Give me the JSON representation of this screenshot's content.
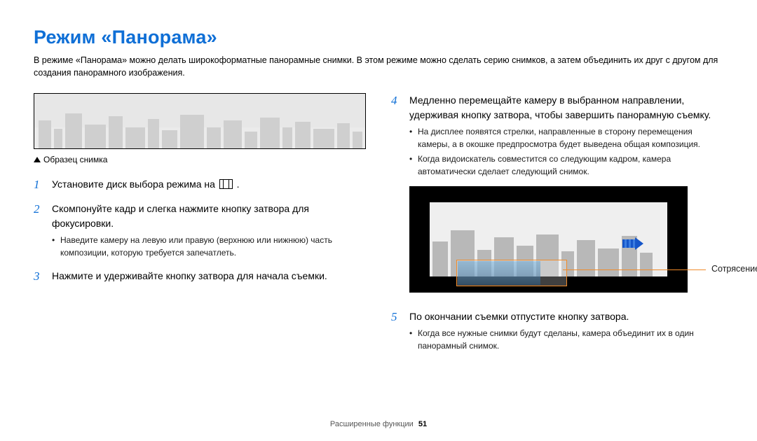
{
  "title": "Режим «Панорама»",
  "intro": "В режиме «Панорама» можно делать широкоформатные панорамные снимки. В этом режиме можно сделать серию снимков, а затем объединить их друг с другом для создания панорамного изображения.",
  "sample_caption": "Образец снимка",
  "left_steps": [
    {
      "num": "1",
      "text_pre": "Установите диск выбора режима на ",
      "text_post": " ."
    },
    {
      "num": "2",
      "text": "Скомпонуйте кадр и слегка нажмите кнопку затвора для фокусировки.",
      "sub": [
        "Наведите камеру на левую или правую (верхнюю или нижнюю) часть композиции, которую требуется запечатлеть."
      ]
    },
    {
      "num": "3",
      "text": "Нажмите и удерживайте кнопку затвора для начала съемки."
    }
  ],
  "right": {
    "step4": {
      "num": "4",
      "text": "Медленно перемещайте камеру в выбранном направлении, удерживая кнопку затвора, чтобы завершить панорамную съемку.",
      "sub": [
        "На дисплее появятся стрелки, направленные в сторону перемещения камеры, а в окошке предпросмотра будет выведена общая композиция.",
        "Когда видоискатель совместится со следующим кадром, камера автоматически сделает следующий снимок."
      ]
    },
    "callout": "Сотрясение",
    "step5": {
      "num": "5",
      "text": "По окончании съемки отпустите кнопку затвора.",
      "sub": [
        "Когда все нужные снимки будут сделаны, камера объединит их в один панорамный снимок."
      ]
    }
  },
  "footer_section": "Расширенные функции",
  "footer_page": "51"
}
